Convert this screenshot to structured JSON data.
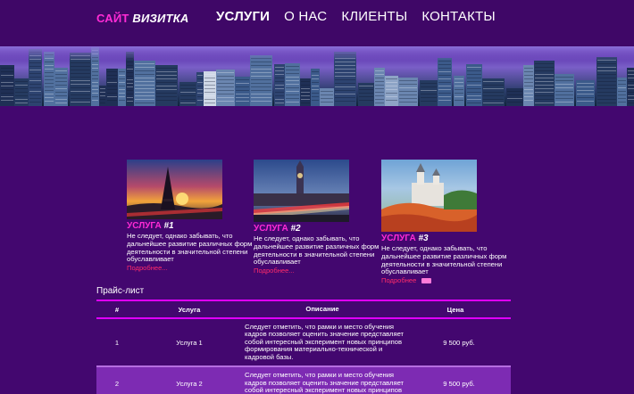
{
  "header": {
    "logo_part1": "САЙТ",
    "logo_part2": "ВИЗИТКА",
    "nav": [
      {
        "label": "УСЛУГИ",
        "active": true
      },
      {
        "label": "О НАС",
        "active": false
      },
      {
        "label": "КЛИЕНТЫ",
        "active": false
      },
      {
        "label": "КОНТАКТЫ",
        "active": false
      }
    ]
  },
  "services": [
    {
      "title_word": "УСЛУГА",
      "title_num": "#1",
      "text": "Не следует, однако забывать, что дальнейшее развитие различных форм деятельности в значительной степени обуславливает",
      "more": "Подробнее..."
    },
    {
      "title_word": "УСЛУГА",
      "title_num": "#2",
      "text": "Не следует, однако забывать, что дальнейшее развитие различных форм деятельности в значительной степени обуславливает",
      "more": "Подробнее..."
    },
    {
      "title_word": "УСЛУГА",
      "title_num": "#3",
      "text": "Не следует, однако забывать, что дальнейшее развитие различных форм деятельности в значительной степени обуславливает",
      "more": "Подробнее"
    }
  ],
  "pricelist": {
    "title": "Прайс-лист",
    "headers": [
      "#",
      "Услуга",
      "Описание",
      "Цена"
    ],
    "rows": [
      {
        "num": "1",
        "service": "Услуга 1",
        "desc": "Следует отметить, что рамки и место обучения кадров позволяет оценить значение представляет собой интересный эксперимент новых принципов формирования материально-технической и кадровой базы.",
        "price": "9 500 руб."
      },
      {
        "num": "2",
        "service": "Услуга 2",
        "desc": "Следует отметить, что рамки и место обучения кадров позволяет оценить значение представляет собой интересный эксперимент новых принципов",
        "price": "9 500 руб."
      }
    ]
  },
  "colors": {
    "background": "#43076f",
    "accent_magenta": "#ff2bd6",
    "link_red": "#ff2b6a",
    "row_alt": "#7d2bb3"
  }
}
